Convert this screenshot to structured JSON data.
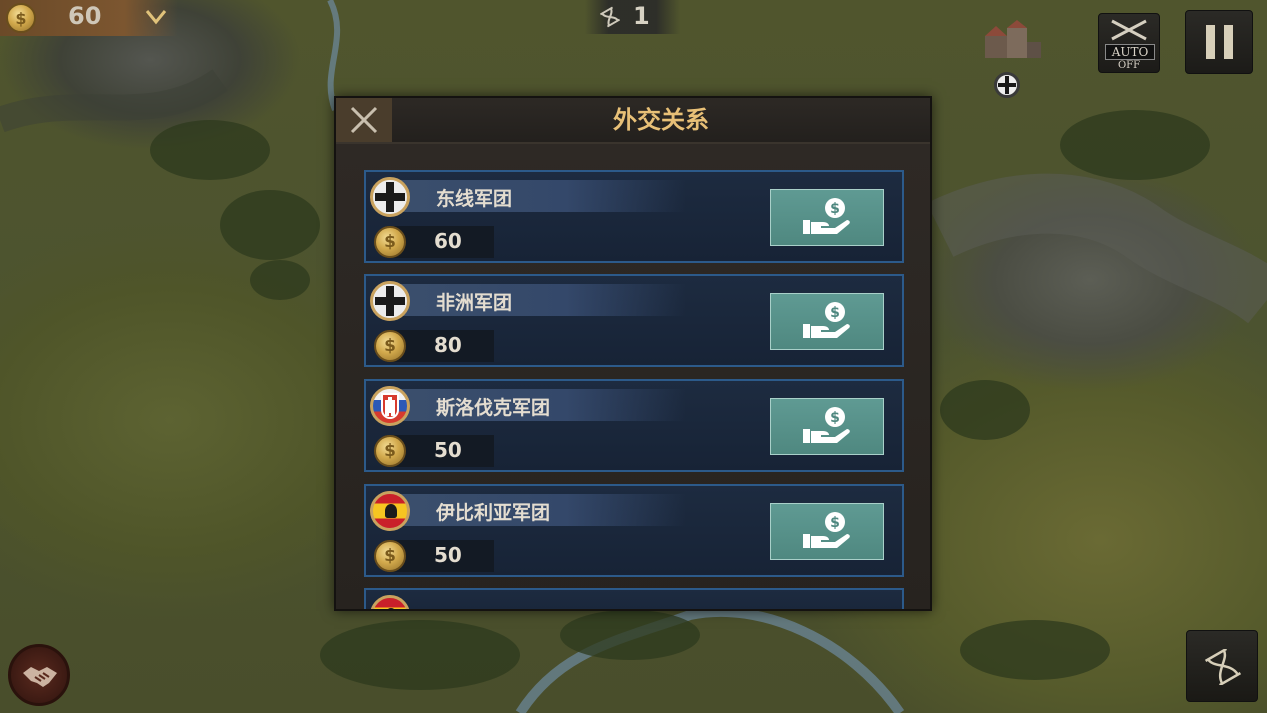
{
  "resources": {
    "gold": "60"
  },
  "turn": {
    "value": "1"
  },
  "controls": {
    "auto_label": "AUTO",
    "auto_state": "OFF"
  },
  "dialog": {
    "title": "外交关系",
    "factions": [
      {
        "name": "东线军团",
        "cost": "60",
        "flag": "iron-cross-flag"
      },
      {
        "name": "非洲军团",
        "cost": "80",
        "flag": "iron-cross-flag"
      },
      {
        "name": "斯洛伐克军团",
        "cost": "50",
        "flag": "slovak-flag"
      },
      {
        "name": "伊比利亚军团",
        "cost": "50",
        "flag": "spanish-flag"
      }
    ]
  },
  "colors": {
    "title": "#e8c077",
    "card_border": "#2c5a8a",
    "bribe_button": "#5a958e"
  }
}
